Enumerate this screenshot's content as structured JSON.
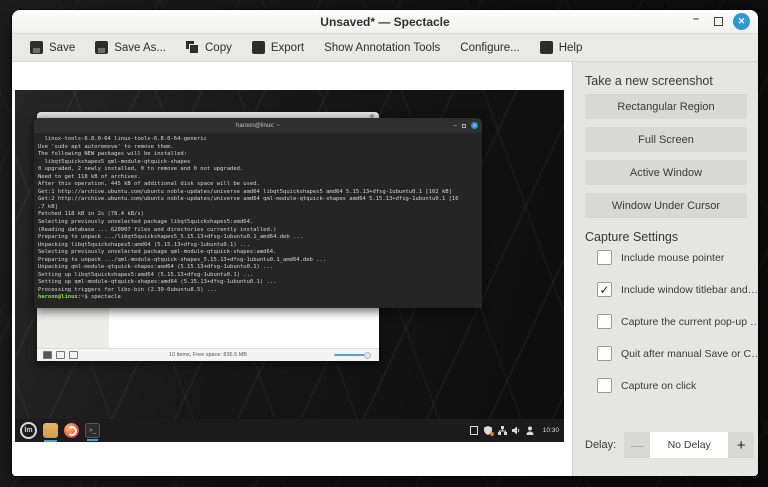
{
  "window": {
    "title": "Unsaved* — Spectacle",
    "controls": {
      "minimize": "–",
      "close": "✕"
    }
  },
  "toolbar": {
    "items": [
      {
        "label": "Save"
      },
      {
        "label": "Save As..."
      },
      {
        "label": "Copy"
      },
      {
        "label": "Export"
      },
      {
        "label": "Show Annotation Tools"
      },
      {
        "label": "Configure..."
      },
      {
        "label": "Help"
      }
    ]
  },
  "side_panel": {
    "new_screenshot_heading": "Take a new screenshot",
    "capture_buttons": [
      {
        "label": "Rectangular Region"
      },
      {
        "label": "Full Screen"
      },
      {
        "label": "Active Window"
      },
      {
        "label": "Window Under Cursor"
      }
    ],
    "capture_settings_heading": "Capture Settings",
    "checkboxes": [
      {
        "label": "Include mouse pointer",
        "checked": false,
        "glyph": ""
      },
      {
        "label": "Include window titlebar and…",
        "checked": true,
        "glyph": "✓"
      },
      {
        "label": "Capture the current pop-up …",
        "checked": false,
        "glyph": ""
      },
      {
        "label": "Quit after manual Save or C…",
        "checked": false,
        "glyph": ""
      },
      {
        "label": "Capture on click",
        "checked": false,
        "glyph": ""
      }
    ],
    "delay": {
      "label": "Delay:",
      "value": "No Delay",
      "minus": "—",
      "plus": "+"
    }
  },
  "preview": {
    "terminal": {
      "title": "haroon@linux: ~",
      "lines": [
        "  linux-tools-6.8.0-64 linux-tools-6.8.0-64-generic",
        "Use 'sudo apt autoremove' to remove them.",
        "The following NEW packages will be installed:",
        "  libqt5quickshapes5 qml-module-qtquick-shapes",
        "0 upgraded, 2 newly installed, 0 to remove and 0 not upgraded.",
        "Need to get 118 kB of archives.",
        "After this operation, 445 kB of additional disk space will be used.",
        "Get:1 http://archive.ubuntu.com/ubuntu noble-updates/universe amd64 libqt5quickshapes5 amd64 5.15.13+dfsg-1ubuntu0.1 [102 kB]",
        "Get:2 http://archive.ubuntu.com/ubuntu noble-updates/universe amd64 qml-module-qtquick-shapes amd64 5.15.13+dfsg-1ubuntu0.1 [16",
        ".7 kB]",
        "Fetched 118 kB in 2s (78.4 kB/s)",
        "Selecting previously unselected package libqt5quickshapes5:amd64.",
        "(Reading database ... 620907 files and directories currently installed.)",
        "Preparing to unpack .../libqt5quickshapes5_5.15.13+dfsg-1ubuntu0.1_amd64.deb ...",
        "Unpacking libqt5quickshapes5:amd64 (5.15.13+dfsg-1ubuntu0.1) ...",
        "Selecting previously unselected package qml-module-qtquick-shapes:amd64.",
        "Preparing to unpack .../qml-module-qtquick-shapes_5.15.13+dfsg-1ubuntu0.1_amd64.deb ...",
        "Unpacking qml-module-qtquick-shapes:amd64 (5.15.13+dfsg-1ubuntu0.1) ...",
        "Setting up libqt5quickshapes5:amd64 (5.15.13+dfsg-1ubuntu0.1) ...",
        "Setting up qml-module-qtquick-shapes:amd64 (5.15.13+dfsg-1ubuntu0.1) ...",
        "Processing triggers for libc-bin (2.39-0ubuntu8.5) ..."
      ],
      "prompt_user": "haroon@linux",
      "prompt_rest": ":~$ spectacle"
    },
    "file_manager": {
      "status_text": "10 items, Free space: 836.5 MB"
    },
    "taskbar": {
      "start_glyph": "lm",
      "terminal_glyph": ">_",
      "clock": "10:30"
    }
  },
  "colors": {
    "accent_close": "#2e97d8",
    "terminal_green": "#8ae234",
    "taskbar_underline": "#3aa3e3",
    "fm_slider": "#49a8df"
  }
}
